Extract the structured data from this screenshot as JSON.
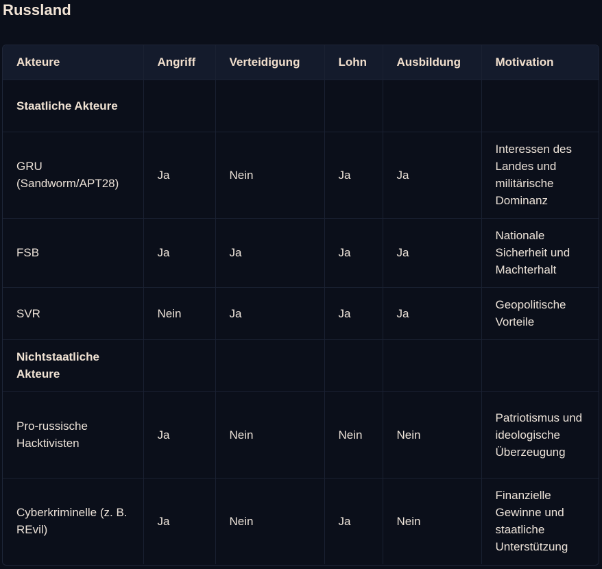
{
  "title": "Russland",
  "columns": [
    "Akteure",
    "Angriff",
    "Verteidigung",
    "Lohn",
    "Ausbildung",
    "Motivation"
  ],
  "rows": [
    {
      "akteur": "Staatliche Akteure",
      "angriff": "",
      "verteidigung": "",
      "lohn": "",
      "ausbildung": "",
      "motivation": ""
    },
    {
      "akteur": "GRU (Sandworm/APT28)",
      "angriff": "Ja",
      "verteidigung": "Nein",
      "lohn": "Ja",
      "ausbildung": "Ja",
      "motivation": "Interessen des Landes und militärische Dominanz"
    },
    {
      "akteur": "FSB",
      "angriff": "Ja",
      "verteidigung": "Ja",
      "lohn": "Ja",
      "ausbildung": "Ja",
      "motivation": "Nationale Sicherheit und Machterhalt"
    },
    {
      "akteur": "SVR",
      "angriff": "Nein",
      "verteidigung": "Ja",
      "lohn": "Ja",
      "ausbildung": "Ja",
      "motivation": "Geopolitische Vorteile"
    },
    {
      "akteur": "Nichtstaatliche Akteure",
      "angriff": "",
      "verteidigung": "",
      "lohn": "",
      "ausbildung": "",
      "motivation": ""
    },
    {
      "akteur": "Pro-russische Hacktivisten",
      "angriff": "Ja",
      "verteidigung": "Nein",
      "lohn": "Nein",
      "ausbildung": "Nein",
      "motivation": "Patriotismus und ideologische Überzeugung"
    },
    {
      "akteur": "Cyberkriminelle (z. B. REvil)",
      "angriff": "Ja",
      "verteidigung": "Nein",
      "lohn": "Ja",
      "ausbildung": "Nein",
      "motivation": "Finanzielle Gewinne und staatliche Unterstützung"
    }
  ]
}
